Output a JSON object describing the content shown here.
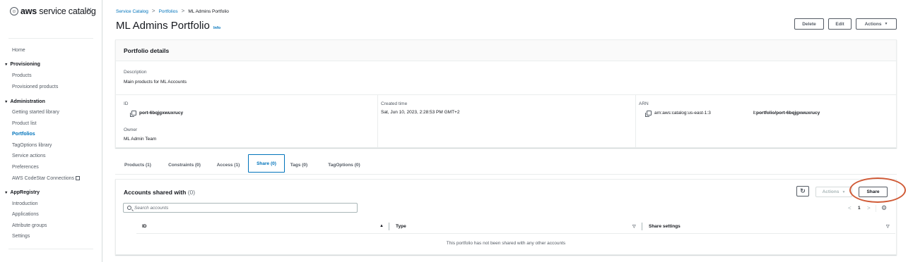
{
  "sidebar": {
    "brand": "aws service catalog",
    "close_glyph": "×",
    "home": "Home",
    "provisioning": {
      "title": "Provisioning",
      "items": [
        "Products",
        "Provisioned products"
      ]
    },
    "administration": {
      "title": "Administration",
      "items": [
        "Getting started library",
        "Product list",
        "Portfolios",
        "TagOptions library",
        "Service actions",
        "Preferences",
        "AWS CodeStar Connections"
      ]
    },
    "appregistry": {
      "title": "AppRegistry",
      "items": [
        "Introduction",
        "Applications",
        "Attribute groups",
        "Settings"
      ]
    },
    "active_item": "Portfolios"
  },
  "breadcrumb": {
    "items": [
      "Service Catalog",
      "Portfolios",
      "ML Admins Portfolio"
    ],
    "separator": ">"
  },
  "page": {
    "title": "ML Admins Portfolio",
    "info_link": "Info"
  },
  "header_actions": {
    "delete": "Delete",
    "edit": "Edit",
    "actions": "Actions",
    "actions_caret": "▼"
  },
  "details": {
    "title": "Portfolio details",
    "description_label": "Description",
    "description_value": "Main products for ML Accounts",
    "id_label": "ID",
    "id_value": "port-6bqjgxwuxrucy",
    "owner_label": "Owner",
    "owner_value": "ML Admin Team",
    "created_label": "Created time",
    "created_value": "Sat, Jun 10, 2023, 2:28:53 PM GMT+2",
    "arn_label": "ARN",
    "arn_part1": "arn:aws:catalog:us-east-1:3",
    "arn_part2": "l:portfolio/port-6bqjgxwuxrucy"
  },
  "tabs": [
    {
      "label": "Products (1)",
      "active": false
    },
    {
      "label": "Constraints (0)",
      "active": false
    },
    {
      "label": "Access (1)",
      "active": false
    },
    {
      "label": "Share (0)",
      "active": true
    },
    {
      "label": "Tags (0)",
      "active": false
    },
    {
      "label": "TagOptions (0)",
      "active": false
    }
  ],
  "shared": {
    "title": "Accounts shared with",
    "count": "(0)",
    "refresh_icon": "↻",
    "actions_button": "Actions",
    "actions_caret": "▼",
    "share_button": "Share",
    "search_placeholder": "Search accounts",
    "pagination": {
      "prev": "<",
      "page": "1",
      "next": ">",
      "settings_icon": "⚙"
    },
    "columns": [
      {
        "label": "ID",
        "sort_icon": "▲"
      },
      {
        "label": "Type",
        "sort_icon": "▽"
      },
      {
        "label": "Share settings",
        "sort_icon": "▽"
      }
    ],
    "empty_message": "This portfolio has not been shared with any other accounts"
  },
  "colors": {
    "link": "#0073bb",
    "text": "#16191f",
    "muted": "#545b64",
    "border": "#eaeded",
    "annotation": "#d05a36"
  }
}
